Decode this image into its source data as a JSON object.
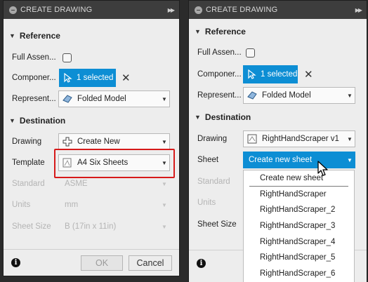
{
  "left": {
    "title": "CREATE DRAWING",
    "reference_header": "Reference",
    "destination_header": "Destination",
    "full_assembly_label": "Full Assen...",
    "components_label": "Componer...",
    "components_selected": "1 selected",
    "representation_label": "Represent...",
    "representation_value": "Folded Model",
    "drawing_label": "Drawing",
    "drawing_value": "Create New",
    "template_label": "Template",
    "template_value": "A4 Six Sheets",
    "standard_label": "Standard",
    "standard_value": "ASME",
    "units_label": "Units",
    "units_value": "mm",
    "sheet_size_label": "Sheet Size",
    "sheet_size_value": "B (17in x 11in)",
    "ok_label": "OK",
    "cancel_label": "Cancel"
  },
  "right": {
    "title": "CREATE DRAWING",
    "reference_header": "Reference",
    "destination_header": "Destination",
    "full_assembly_label": "Full Assen...",
    "components_label": "Componer...",
    "components_selected": "1 selected",
    "representation_label": "Represent...",
    "representation_value": "Folded Model",
    "drawing_label": "Drawing",
    "drawing_value": "RightHandScraper v1",
    "sheet_label": "Sheet",
    "sheet_value": "Create new sheet",
    "standard_label": "Standard",
    "units_label": "Units",
    "sheet_size_label": "Sheet Size",
    "sheet_menu": [
      "Create new sheet",
      "RightHandScraper",
      "RightHandScraper_2",
      "RightHandScraper_3",
      "RightHandScraper_4",
      "RightHandScraper_5",
      "RightHandScraper_6"
    ]
  },
  "colors": {
    "accent": "#0d8ed4",
    "highlight": "#d61a1a",
    "titlebar": "#3d3d3d",
    "panel": "#ededed"
  },
  "icons": [
    "collapse-icon",
    "expand-icon",
    "select-cursor-icon",
    "clear-x-icon",
    "folded-model-icon",
    "create-new-plus-icon",
    "template-sheet-icon",
    "drawing-doc-icon",
    "info-icon",
    "mouse-pointer-icon"
  ]
}
